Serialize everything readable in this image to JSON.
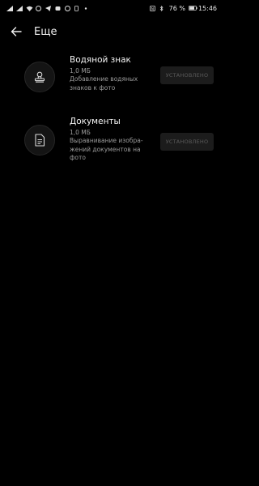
{
  "status_bar": {
    "battery_percent": "76 %",
    "time": "15:46"
  },
  "header": {
    "title": "Еще"
  },
  "items": [
    {
      "title": "Водяной знак",
      "size": "1,0 МБ",
      "description": "Добавление водяных знаков к фото",
      "button": "УСТАНОВЛЕНО"
    },
    {
      "title": "Документы",
      "size": "1,0 МБ",
      "description": "Выравнивание изобра-жений документов на фото",
      "button": "УСТАНОВЛЕНО"
    }
  ],
  "icons": {
    "back": "arrow-left-icon",
    "watermark": "stamp-icon",
    "documents": "document-icon"
  }
}
